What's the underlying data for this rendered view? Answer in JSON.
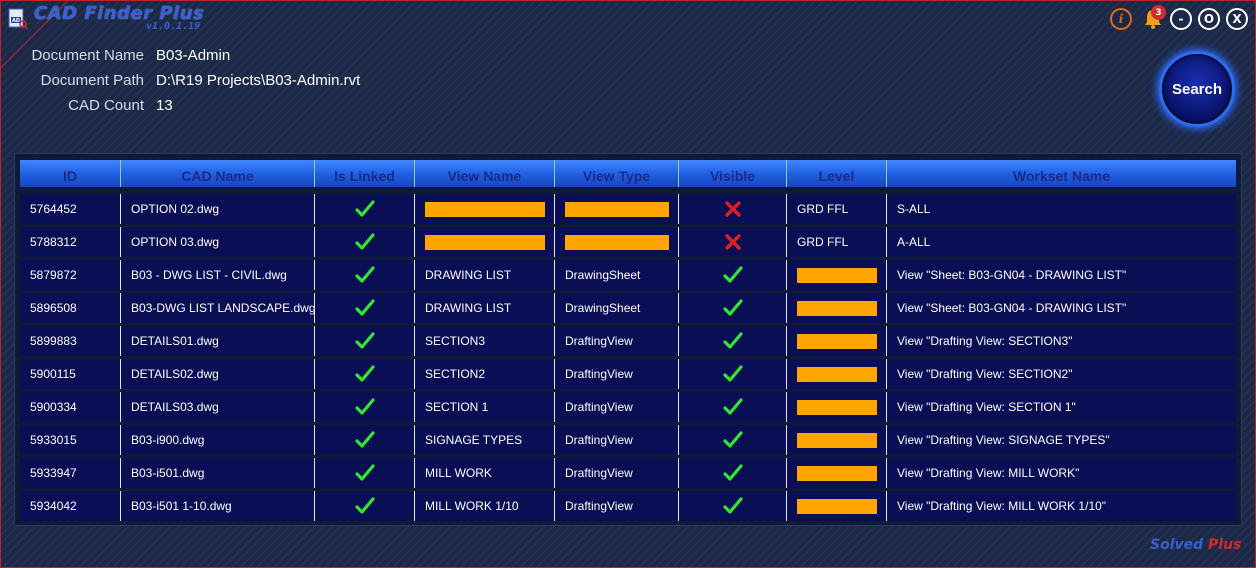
{
  "app": {
    "title": "CAD Finder Plus",
    "version": "v1.0.1.19",
    "notification_count": "3",
    "brand_solved": "Solved",
    "brand_plus": "Plus"
  },
  "window_controls": {
    "info": "i",
    "minimize": "-",
    "maximize": "O",
    "close": "X"
  },
  "document": {
    "name_label": "Document Name",
    "name_value": "B03-Admin",
    "path_label": "Document Path",
    "path_value": "D:\\R19 Projects\\B03-Admin.rvt",
    "count_label": "CAD Count",
    "count_value": "13"
  },
  "search_button": "Search",
  "colors": {
    "accent": "#2b6cf0",
    "bar": "#ffa500",
    "check": "#33e633",
    "cross": "#e02020",
    "row_bg": "#0a0e54",
    "header_text": "#1a2a8a"
  },
  "table": {
    "columns": [
      "ID",
      "CAD Name",
      "Is Linked",
      "View Name",
      "View Type",
      "Visible",
      "Level",
      "Workset Name"
    ],
    "rows": [
      {
        "id": "5764452",
        "cad_name": "OPTION 02.dwg",
        "linked": true,
        "view_name": "",
        "view_type": "",
        "visible": false,
        "level": "GRD FFL",
        "workset": "S-ALL"
      },
      {
        "id": "5788312",
        "cad_name": "OPTION 03.dwg",
        "linked": true,
        "view_name": "",
        "view_type": "",
        "visible": false,
        "level": "GRD FFL",
        "workset": "A-ALL"
      },
      {
        "id": "5879872",
        "cad_name": "B03 - DWG LIST - CIVIL.dwg",
        "linked": true,
        "view_name": "DRAWING LIST",
        "view_type": "DrawingSheet",
        "visible": true,
        "level": "",
        "workset": "View \"Sheet: B03-GN04 - DRAWING LIST\""
      },
      {
        "id": "5896508",
        "cad_name": "B03-DWG LIST LANDSCAPE.dwg",
        "linked": true,
        "view_name": "DRAWING LIST",
        "view_type": "DrawingSheet",
        "visible": true,
        "level": "",
        "workset": "View \"Sheet: B03-GN04 - DRAWING LIST\""
      },
      {
        "id": "5899883",
        "cad_name": "DETAILS01.dwg",
        "linked": true,
        "view_name": "SECTION3",
        "view_type": "DraftingView",
        "visible": true,
        "level": "",
        "workset": "View \"Drafting View: SECTION3\""
      },
      {
        "id": "5900115",
        "cad_name": "DETAILS02.dwg",
        "linked": true,
        "view_name": "SECTION2",
        "view_type": "DraftingView",
        "visible": true,
        "level": "",
        "workset": "View \"Drafting View: SECTION2\""
      },
      {
        "id": "5900334",
        "cad_name": "DETAILS03.dwg",
        "linked": true,
        "view_name": "SECTION 1",
        "view_type": "DraftingView",
        "visible": true,
        "level": "",
        "workset": "View \"Drafting View: SECTION 1\""
      },
      {
        "id": "5933015",
        "cad_name": "B03-i900.dwg",
        "linked": true,
        "view_name": "SIGNAGE TYPES",
        "view_type": "DraftingView",
        "visible": true,
        "level": "",
        "workset": "View \"Drafting View: SIGNAGE TYPES\""
      },
      {
        "id": "5933947",
        "cad_name": "B03-i501.dwg",
        "linked": true,
        "view_name": "MILL WORK",
        "view_type": "DraftingView",
        "visible": true,
        "level": "",
        "workset": "View \"Drafting View: MILL WORK\""
      },
      {
        "id": "5934042",
        "cad_name": "B03-i501 1-10.dwg",
        "linked": true,
        "view_name": "MILL WORK 1/10",
        "view_type": "DraftingView",
        "visible": true,
        "level": "",
        "workset": "View \"Drafting View: MILL WORK 1/10\""
      }
    ]
  }
}
